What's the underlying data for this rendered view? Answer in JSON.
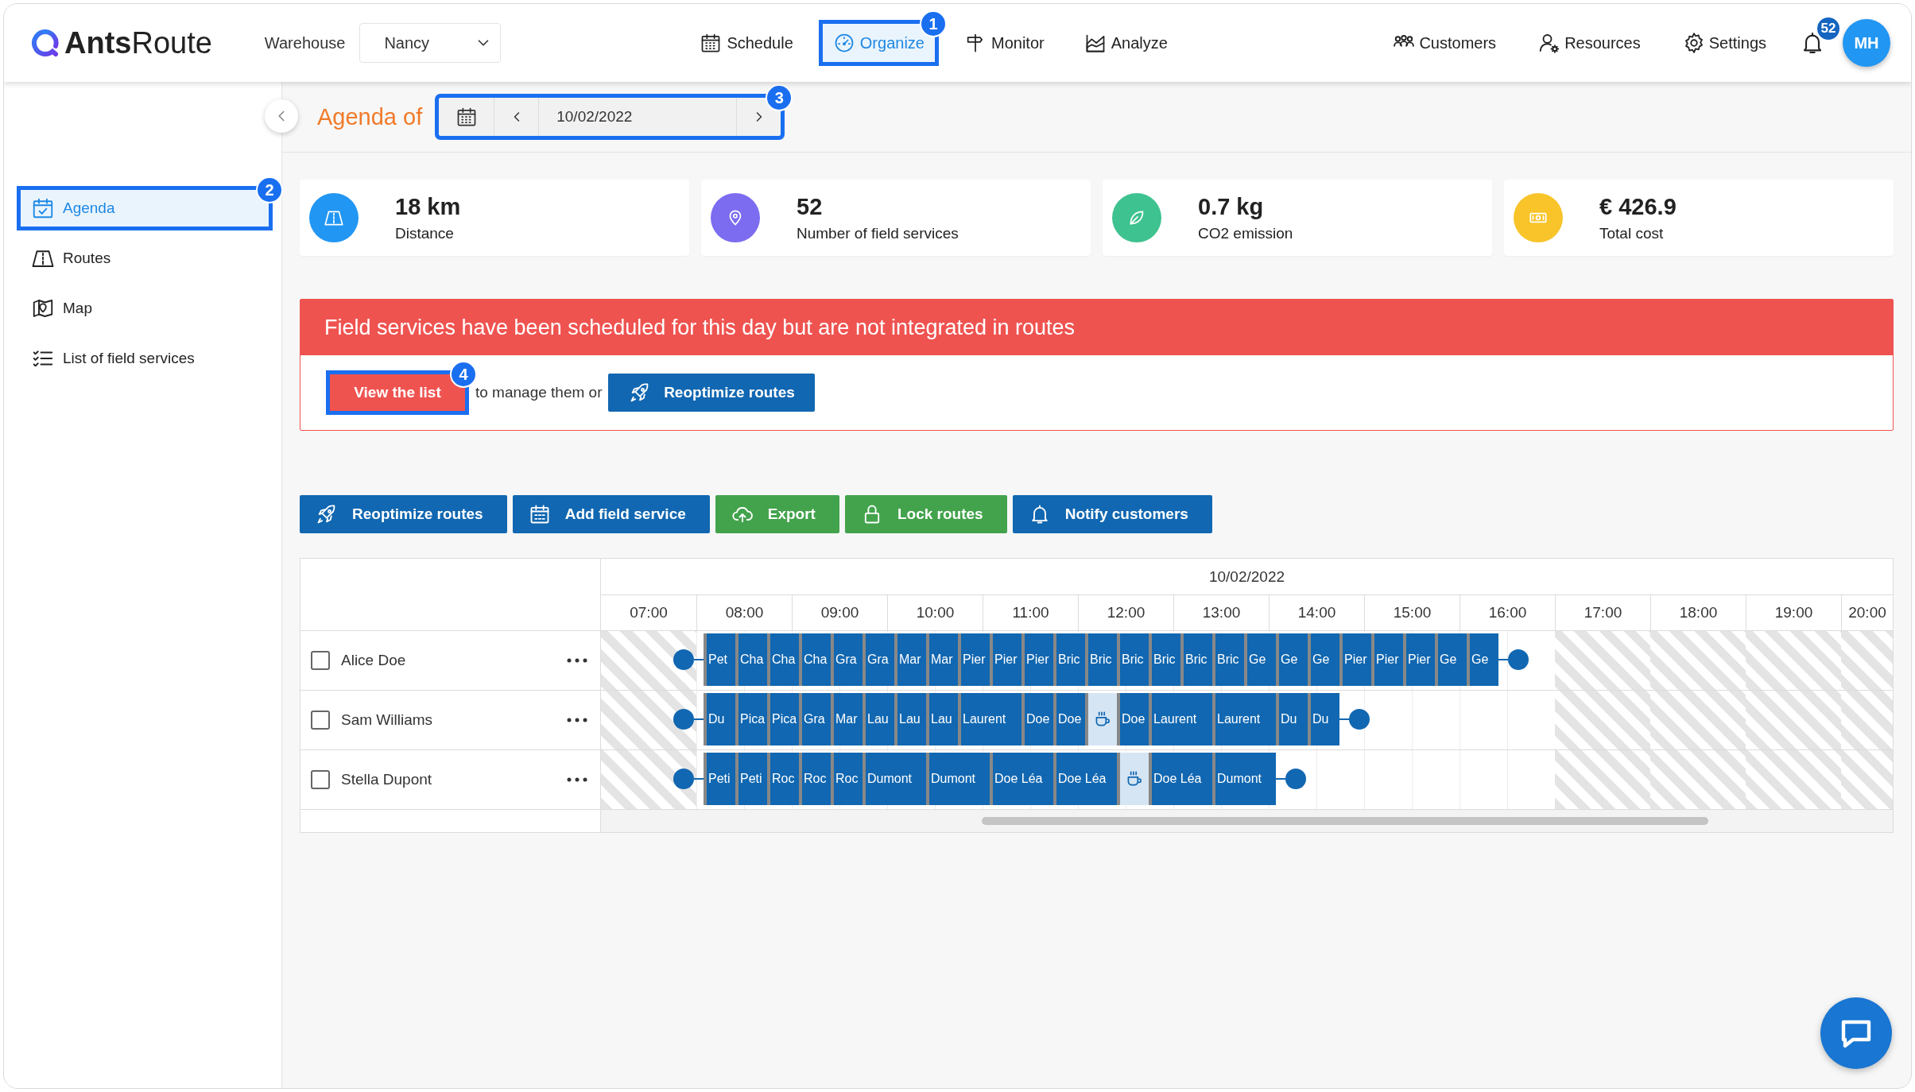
{
  "header": {
    "logo": "**Ants**Route",
    "warehouse": {
      "label": "Warehouse",
      "value": "Nancy"
    },
    "nav": [
      {
        "label": "Schedule",
        "selected": false
      },
      {
        "label": "Organize",
        "selected": true,
        "callout": "1"
      },
      {
        "label": "Monitor",
        "selected": false
      },
      {
        "label": "Analyze",
        "selected": false
      }
    ],
    "right_nav": [
      {
        "label": "Customers"
      },
      {
        "label": "Resources"
      },
      {
        "label": "Settings"
      }
    ],
    "notifications": {
      "count": "52"
    },
    "avatar": {
      "initials": "MH"
    }
  },
  "sidebar": {
    "items": [
      {
        "label": "Agenda",
        "selected": true,
        "callout": "2"
      },
      {
        "label": "Routes",
        "selected": false
      },
      {
        "label": "Map",
        "selected": false
      },
      {
        "label": "List of field services",
        "selected": false
      }
    ]
  },
  "agenda_bar": {
    "title": "Agenda of",
    "date": "10/02/2022",
    "callout": "3"
  },
  "stats": [
    {
      "value": "18 km",
      "label": "Distance",
      "color": "#2196f3"
    },
    {
      "value": "52",
      "label": "Number of field services",
      "color": "#7b6cf0"
    },
    {
      "value": "0.7 kg",
      "label": "CO2 emission",
      "color": "#3ec28f"
    },
    {
      "value": "€ 426.9",
      "label": "Total cost",
      "color": "#f8c42a"
    }
  ],
  "alert": {
    "message": "Field services have been scheduled for this day but are not integrated in routes",
    "primary_button": {
      "label": "View the list",
      "callout": "4"
    },
    "connector": "to manage them or",
    "secondary_button": {
      "label": "Reoptimize routes"
    }
  },
  "actions": [
    {
      "label": "Reoptimize routes",
      "color": "#1167b1"
    },
    {
      "label": "Add field service",
      "color": "#1167b1"
    },
    {
      "label": "Export",
      "color": "#43a34c"
    },
    {
      "label": "Lock routes",
      "color": "#43a34c"
    },
    {
      "label": "Notify customers",
      "color": "#1167b1"
    }
  ],
  "gantt": {
    "date": "10/02/2022",
    "hours": [
      {
        "label": "07:00",
        "available": false
      },
      {
        "label": "08:00",
        "available": true
      },
      {
        "label": "09:00",
        "available": true
      },
      {
        "label": "10:00",
        "available": true
      },
      {
        "label": "11:00",
        "available": true
      },
      {
        "label": "12:00",
        "available": true
      },
      {
        "label": "13:00",
        "available": true
      },
      {
        "label": "14:00",
        "available": true
      },
      {
        "label": "15:00",
        "available": true
      },
      {
        "label": "16:00",
        "available": true
      },
      {
        "label": "17:00",
        "available": false
      },
      {
        "label": "18:00",
        "available": false
      },
      {
        "label": "19:00",
        "available": false
      },
      {
        "label": "20:00",
        "available": false
      }
    ],
    "rows": [
      {
        "name": "Alice Doe",
        "checked": false,
        "tasks": [
          {
            "kind": "visit",
            "label": "Pet"
          },
          {
            "kind": "visit",
            "label": "Cha"
          },
          {
            "kind": "visit",
            "label": "Cha"
          },
          {
            "kind": "visit",
            "label": "Cha"
          },
          {
            "kind": "visit",
            "label": "Gra"
          },
          {
            "kind": "visit",
            "label": "Gra"
          },
          {
            "kind": "visit",
            "label": "Mar"
          },
          {
            "kind": "visit",
            "label": "Mar"
          },
          {
            "kind": "visit",
            "label": "Pier"
          },
          {
            "kind": "visit",
            "label": "Pier"
          },
          {
            "kind": "visit",
            "label": "Pier"
          },
          {
            "kind": "visit",
            "label": "Bric"
          },
          {
            "kind": "visit",
            "label": "Bric"
          },
          {
            "kind": "visit",
            "label": "Bric"
          },
          {
            "kind": "visit",
            "label": "Bric"
          },
          {
            "kind": "visit",
            "label": "Bric"
          },
          {
            "kind": "visit",
            "label": "Bric"
          },
          {
            "kind": "visit",
            "label": "Ge"
          },
          {
            "kind": "visit",
            "label": "Ge"
          },
          {
            "kind": "visit",
            "label": "Ge"
          },
          {
            "kind": "visit",
            "label": "Pier"
          },
          {
            "kind": "visit",
            "label": "Pier"
          },
          {
            "kind": "visit",
            "label": "Pier"
          },
          {
            "kind": "visit",
            "label": "Ge"
          },
          {
            "kind": "visit",
            "label": "Ge"
          }
        ]
      },
      {
        "name": "Sam Williams",
        "checked": false,
        "tasks": [
          {
            "kind": "visit",
            "label": "Du"
          },
          {
            "kind": "visit",
            "label": "Pica"
          },
          {
            "kind": "visit",
            "label": "Pica"
          },
          {
            "kind": "visit",
            "label": "Gra"
          },
          {
            "kind": "visit",
            "label": "Mar"
          },
          {
            "kind": "visit",
            "label": "Lau"
          },
          {
            "kind": "visit",
            "label": "Lau"
          },
          {
            "kind": "visit",
            "label": "Lau"
          },
          {
            "kind": "long_visit",
            "label": "Laurent"
          },
          {
            "kind": "visit",
            "label": "Doe"
          },
          {
            "kind": "visit",
            "label": "Doe"
          },
          {
            "kind": "break"
          },
          {
            "kind": "visit",
            "label": "Doe"
          },
          {
            "kind": "long_visit",
            "label": "Laurent"
          },
          {
            "kind": "long_visit",
            "label": "Laurent"
          },
          {
            "kind": "visit",
            "label": "Du"
          },
          {
            "kind": "visit",
            "label": "Du"
          }
        ]
      },
      {
        "name": "Stella Dupont",
        "checked": false,
        "tasks": [
          {
            "kind": "visit",
            "label": "Peti"
          },
          {
            "kind": "visit",
            "label": "Peti"
          },
          {
            "kind": "visit",
            "label": "Roc"
          },
          {
            "kind": "visit",
            "label": "Roc"
          },
          {
            "kind": "visit",
            "label": "Roc"
          },
          {
            "kind": "long_visit",
            "label": "Dumont"
          },
          {
            "kind": "long_visit",
            "label": "Dumont"
          },
          {
            "kind": "long_visit",
            "label": "Doe Léa"
          },
          {
            "kind": "long_visit",
            "label": "Doe Léa"
          },
          {
            "kind": "break"
          },
          {
            "kind": "long_visit",
            "label": "Doe Léa"
          },
          {
            "kind": "long_visit",
            "label": "Dumont"
          }
        ]
      }
    ]
  }
}
